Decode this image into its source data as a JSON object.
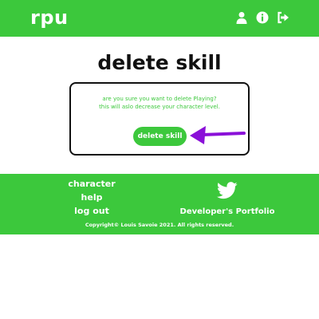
{
  "header": {
    "logo": "rpu",
    "icons": [
      "user-icon",
      "info-icon",
      "logout-icon"
    ],
    "color": "#3cc83c"
  },
  "main": {
    "title": "delete skill",
    "message_line1": "are you sure you want to delete Playing?",
    "message_line2": "this will aslo decrease your character level.",
    "delete_button": "delete skill",
    "arrow_color": "#8a10d8"
  },
  "footer": {
    "links": [
      "character",
      "help",
      "log out"
    ],
    "portfolio_label": "Developer's Portfolio",
    "social_icon": "twitter-icon",
    "copyright": "Copyright© Louis Savoie 2021. All rights reserved."
  }
}
